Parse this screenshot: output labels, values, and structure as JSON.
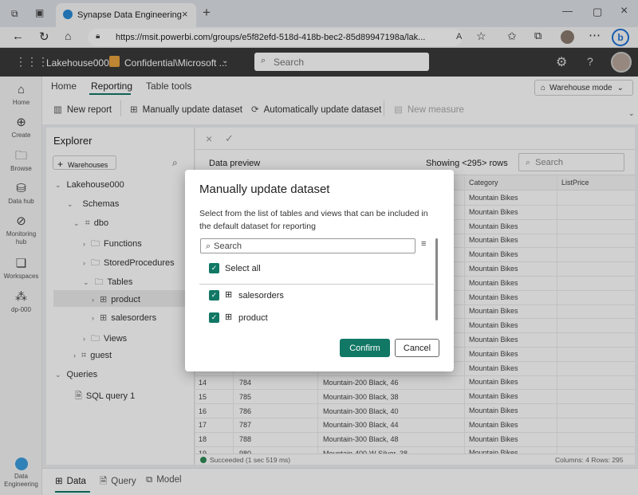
{
  "browser": {
    "tab_title": "Synapse Data Engineering",
    "url": "https://msit.powerbi.com/groups/e5f82efd-518d-418b-bec2-85d89947198a/lak..."
  },
  "app_header": {
    "workspace": "Lakehouse000",
    "sensitivity": "Confidential\\Microsoft ...",
    "search_placeholder": "Search"
  },
  "rail": {
    "items": [
      "Home",
      "Create",
      "Browse",
      "Data hub",
      "Monitoring hub",
      "Workspaces",
      "dp-000"
    ],
    "bottom": "Data Engineering"
  },
  "ribbon": {
    "tabs": [
      "Home",
      "Reporting",
      "Table tools"
    ],
    "mode": "Warehouse mode",
    "buttons": [
      "New report",
      "Manually update dataset",
      "Automatically update dataset",
      "New measure"
    ]
  },
  "explorer": {
    "title": "Explorer",
    "add_button": "Warehouses",
    "tree": {
      "lakehouse": "Lakehouse000",
      "schemas": "Schemas",
      "dbo": "dbo",
      "functions": "Functions",
      "stored_procedures": "StoredProcedures",
      "tables": "Tables",
      "product": "product",
      "salesorders": "salesorders",
      "views": "Views",
      "guest": "guest",
      "queries": "Queries",
      "sql_query": "SQL query 1"
    }
  },
  "preview": {
    "title": "Data preview",
    "showing": "Showing <295> rows",
    "search_placeholder": "Search",
    "columns": [
      "Category",
      "ListPrice"
    ],
    "category_values": [
      "Mountain Bikes",
      "Mountain Bikes",
      "Mountain Bikes",
      "Mountain Bikes",
      "Mountain Bikes",
      "Mountain Bikes",
      "Mountain Bikes",
      "Mountain Bikes",
      "Mountain Bikes",
      "Mountain Bikes",
      "Mountain Bikes",
      "Mountain Bikes",
      "Mountain Bikes",
      "Mountain Bikes",
      "Mountain Bikes",
      "Mountain Bikes",
      "Mountain Bikes",
      "Mountain Bikes",
      "Mountain Bikes"
    ],
    "bottom_rows": [
      {
        "n": "14",
        "id": "784",
        "name": "Mountain-200 Black, 46",
        "cat": "Mountain Bikes"
      },
      {
        "n": "15",
        "id": "785",
        "name": "Mountain-300 Black, 38",
        "cat": "Mountain Bikes"
      },
      {
        "n": "16",
        "id": "786",
        "name": "Mountain-300 Black, 40",
        "cat": "Mountain Bikes"
      },
      {
        "n": "17",
        "id": "787",
        "name": "Mountain-300 Black, 44",
        "cat": "Mountain Bikes"
      },
      {
        "n": "18",
        "id": "788",
        "name": "Mountain-300 Black, 48",
        "cat": "Mountain Bikes"
      },
      {
        "n": "19",
        "id": "980",
        "name": "Mountain-400-W Silver, 38",
        "cat": "Mountain Bikes"
      }
    ],
    "status": "Succeeded (1 sec 519 ms)",
    "counts": "Columns: 4  Rows: 295"
  },
  "bottom_tabs": [
    "Data",
    "Query",
    "Model"
  ],
  "modal": {
    "title": "Manually update dataset",
    "description": "Select from the list of tables and views that can be included in the default dataset for reporting",
    "search_placeholder": "Search",
    "select_all": "Select all",
    "items": [
      "salesorders",
      "product"
    ],
    "confirm": "Confirm",
    "cancel": "Cancel"
  },
  "colors": {
    "accent": "#117865",
    "header": "#3a3a3a"
  }
}
